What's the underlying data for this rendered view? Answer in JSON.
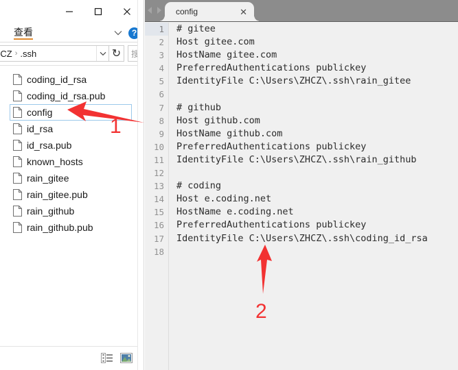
{
  "explorer": {
    "window_controls": [
      {
        "name": "minimize-button",
        "glyph": "minimize-icon"
      },
      {
        "name": "maximize-button",
        "glyph": "maximize-icon"
      },
      {
        "name": "close-button",
        "glyph": "close-icon"
      }
    ],
    "ribbon": {
      "active_tab": "查看",
      "expand_icon": "chevron-down-icon",
      "help_icon": "question-mark-icon",
      "help_label": "?"
    },
    "address": {
      "crumbs": [
        "HCZ",
        ".ssh"
      ],
      "separator": "›",
      "dropdown_icon": "chevron-down-icon",
      "refresh_icon": "refresh-icon",
      "refresh_glyph": "↻",
      "search_placeholder": "搜"
    },
    "files": [
      {
        "name": "coding_id_rsa",
        "selected": false
      },
      {
        "name": "coding_id_rsa.pub",
        "selected": false
      },
      {
        "name": "config",
        "selected": true
      },
      {
        "name": "id_rsa",
        "selected": false
      },
      {
        "name": "id_rsa.pub",
        "selected": false
      },
      {
        "name": "known_hosts",
        "selected": false
      },
      {
        "name": "rain_gitee",
        "selected": false
      },
      {
        "name": "rain_gitee.pub",
        "selected": false
      },
      {
        "name": "rain_github",
        "selected": false
      },
      {
        "name": "rain_github.pub",
        "selected": false
      }
    ],
    "view_toggles": [
      {
        "name": "details-view-icon"
      },
      {
        "name": "large-icons-view-icon"
      }
    ]
  },
  "editor": {
    "nav_back_icon": "arrow-left-icon",
    "nav_forward_icon": "arrow-right-icon",
    "tab": {
      "label": "config",
      "close_icon": "close-icon",
      "close_glyph": "✕"
    },
    "lines": [
      {
        "n": "1",
        "text": "# gitee",
        "active": true
      },
      {
        "n": "2",
        "text": "Host gitee.com",
        "active": false
      },
      {
        "n": "3",
        "text": "HostName gitee.com",
        "active": false
      },
      {
        "n": "4",
        "text": "PreferredAuthentications publickey",
        "active": false
      },
      {
        "n": "5",
        "text": "IdentityFile C:\\Users\\ZHCZ\\.ssh\\rain_gitee",
        "active": false
      },
      {
        "n": "6",
        "text": "",
        "active": false
      },
      {
        "n": "7",
        "text": "# github",
        "active": false
      },
      {
        "n": "8",
        "text": "Host github.com",
        "active": false
      },
      {
        "n": "9",
        "text": "HostName github.com",
        "active": false
      },
      {
        "n": "10",
        "text": "PreferredAuthentications publickey",
        "active": false
      },
      {
        "n": "11",
        "text": "IdentityFile C:\\Users\\ZHCZ\\.ssh\\rain_github",
        "active": false
      },
      {
        "n": "12",
        "text": "",
        "active": false
      },
      {
        "n": "13",
        "text": "# coding",
        "active": false
      },
      {
        "n": "14",
        "text": "Host e.coding.net",
        "active": false
      },
      {
        "n": "15",
        "text": "HostName e.coding.net",
        "active": false
      },
      {
        "n": "16",
        "text": "PreferredAuthentications publickey",
        "active": false
      },
      {
        "n": "17",
        "text": "IdentityFile C:\\Users\\ZHCZ\\.ssh\\coding_id_rsa",
        "active": false
      },
      {
        "n": "18",
        "text": "",
        "active": false
      }
    ]
  },
  "annotations": {
    "color": "#f23232",
    "marker_1": "1",
    "marker_2": "2"
  }
}
